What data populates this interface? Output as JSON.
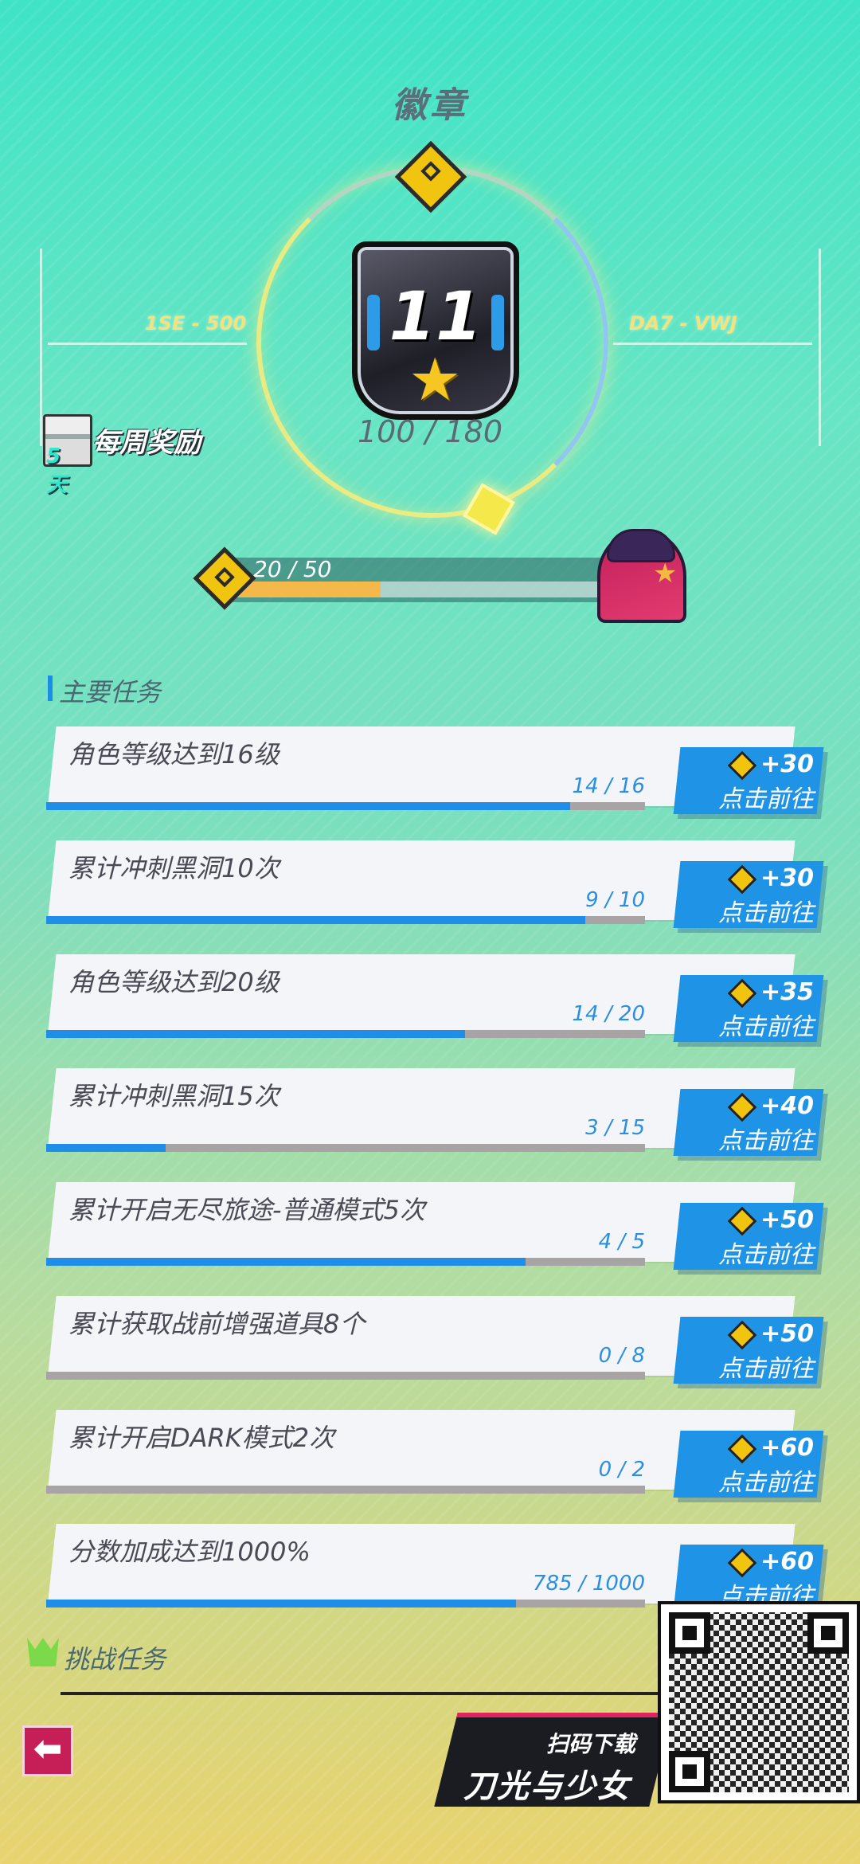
{
  "header": {
    "title": "徽章"
  },
  "badge": {
    "level": "11",
    "exp": "100 / 180",
    "left_code": "1SE - 500",
    "right_code": "DA7 - VWJ"
  },
  "weekly_reward": {
    "label": "每周奖励",
    "days": "5天"
  },
  "level_bar": {
    "text": "20 / 50",
    "progress": 0.4
  },
  "main_tasks": {
    "title": "主要任务",
    "items": [
      {
        "title": "角色等级达到16级",
        "progress_text": "14 / 16",
        "progress": 0.875,
        "reward": "+30",
        "button": "点击前往"
      },
      {
        "title": "累计冲刺黑洞10次",
        "progress_text": "9 / 10",
        "progress": 0.9,
        "reward": "+30",
        "button": "点击前往"
      },
      {
        "title": "角色等级达到20级",
        "progress_text": "14 / 20",
        "progress": 0.7,
        "reward": "+35",
        "button": "点击前往"
      },
      {
        "title": "累计冲刺黑洞15次",
        "progress_text": "3 / 15",
        "progress": 0.2,
        "reward": "+40",
        "button": "点击前往"
      },
      {
        "title": "累计开启无尽旅途-普通模式5次",
        "progress_text": "4 / 5",
        "progress": 0.8,
        "reward": "+50",
        "button": "点击前往"
      },
      {
        "title": "累计获取战前增强道具8个",
        "progress_text": "0 / 8",
        "progress": 0.0,
        "reward": "+50",
        "button": "点击前往"
      },
      {
        "title": "累计开启DARK模式2次",
        "progress_text": "0 / 2",
        "progress": 0.0,
        "reward": "+60",
        "button": "点击前往"
      },
      {
        "title": "分数加成达到1000%",
        "progress_text": "785 / 1000",
        "progress": 0.785,
        "reward": "+60",
        "button": "点击前往"
      }
    ]
  },
  "challenge_tasks": {
    "title": "挑战任务"
  },
  "promo": {
    "small": "扫码下载",
    "big": "刀光与少女"
  },
  "icons": {
    "back": "back-arrow-icon",
    "coin": "badge-coin-icon",
    "gift": "gift-icon",
    "crown": "crown-icon",
    "star": "star-icon"
  },
  "colors": {
    "accent_blue": "#1f94e6",
    "level_fill": "#f4b94a",
    "back_red": "#c61f57"
  }
}
